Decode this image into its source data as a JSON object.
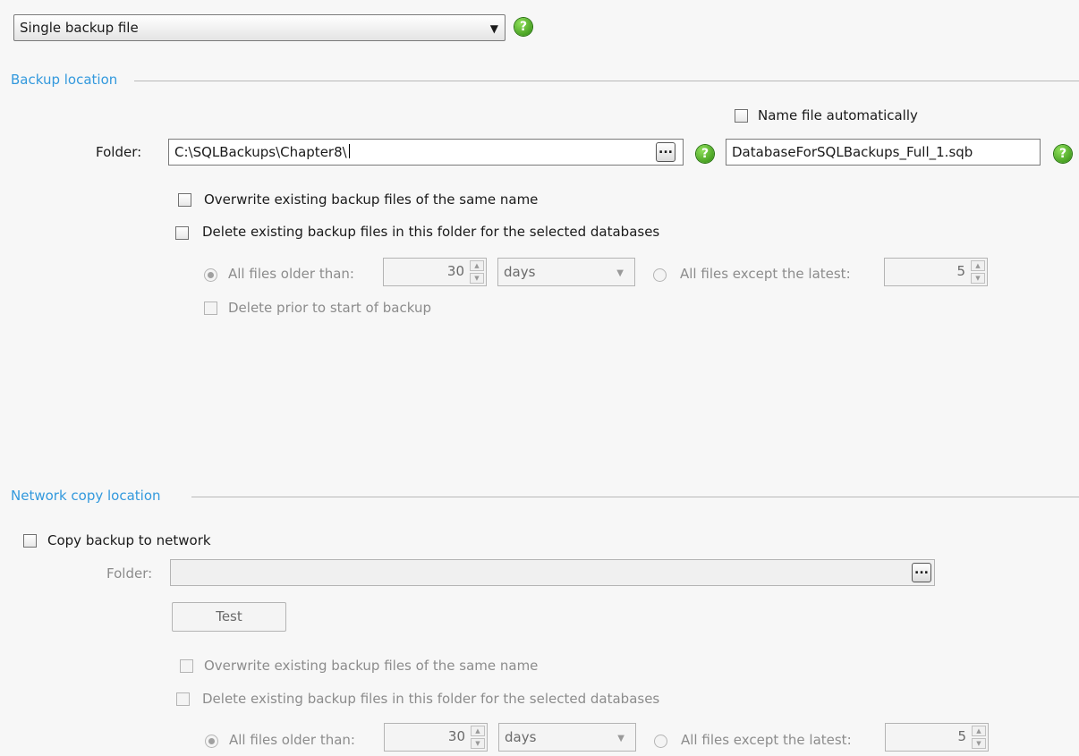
{
  "backup_type": {
    "selected": "Single backup file"
  },
  "backup_location": {
    "title": "Backup location",
    "name_auto_label": "Name file automatically",
    "folder_label": "Folder:",
    "folder_value": "C:\\SQLBackups\\Chapter8\\",
    "browse_label": "...",
    "filename_value": "DatabaseForSQLBackups_Full_1.sqb",
    "overwrite_label": "Overwrite existing backup files of the same name",
    "delete_label": "Delete existing backup files in this folder for the selected databases",
    "older_label": "All files older than:",
    "older_value": "30",
    "unit_value": "days",
    "except_label": "All files except the latest:",
    "except_value": "5",
    "delete_prior_label": "Delete prior to start of backup"
  },
  "network": {
    "title": "Network copy location",
    "copy_label": "Copy backup to network",
    "folder_label": "Folder:",
    "folder_value": "",
    "browse_label": "...",
    "test_label": "Test",
    "overwrite_label": "Overwrite existing backup files of the same name",
    "delete_label": "Delete existing backup files in this folder for the selected databases",
    "older_label": "All files older than:",
    "older_value": "30",
    "unit_value": "days",
    "except_label": "All files except the latest:",
    "except_value": "5"
  },
  "help_glyph": "?",
  "icons": {
    "help": "help-icon",
    "browse": "ellipsis-icon",
    "dropdown": "chevron-down-icon"
  },
  "colors": {
    "section_title": "#3399dd",
    "help_icon": "#2e8a0e"
  }
}
